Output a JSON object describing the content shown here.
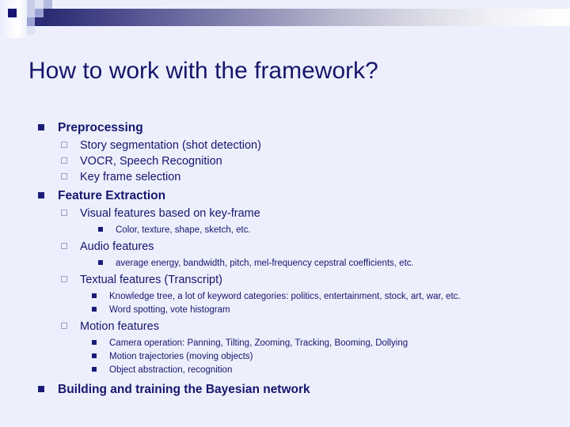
{
  "slide": {
    "title": "How to work with the framework?",
    "background_color": "#edf0fc",
    "text_color": "#15156e",
    "accent_color": "#1b1b78",
    "decoration": {
      "gradient_from": "#26266e",
      "gradient_to": "#ffffff"
    },
    "outline": [
      {
        "level": 1,
        "bullet": "filled-square-bullet",
        "text": "Preprocessing"
      },
      {
        "level": 2,
        "bullet": "hollow-square-bullet",
        "text": "Story segmentation (shot detection)"
      },
      {
        "level": 2,
        "bullet": "hollow-square-bullet",
        "text": "VOCR, Speech Recognition"
      },
      {
        "level": 2,
        "bullet": "hollow-square-bullet",
        "text": "Key frame selection"
      },
      {
        "level": 1,
        "bullet": "filled-square-bullet",
        "text": "Feature Extraction"
      },
      {
        "level": 2,
        "bullet": "hollow-square-bullet",
        "text": "Visual features based on key-frame"
      },
      {
        "level": 3,
        "bullet": "small-filled-square-bullet",
        "text": "Color, texture, shape, sketch, etc."
      },
      {
        "level": 2,
        "bullet": "hollow-square-bullet",
        "text": "Audio features"
      },
      {
        "level": 3,
        "bullet": "small-filled-square-bullet",
        "text": "average energy, bandwidth, pitch, mel-frequency cepstral coefficients, etc."
      },
      {
        "level": 2,
        "bullet": "hollow-square-bullet",
        "text": "Textual features (Transcript)"
      },
      {
        "level": 3,
        "bullet": "small-filled-square-bullet",
        "text": "Knowledge tree, a lot of keyword categories: politics, entertainment, stock, art, war, etc."
      },
      {
        "level": 3,
        "bullet": "small-filled-square-bullet",
        "text": "Word spotting, vote histogram"
      },
      {
        "level": 2,
        "bullet": "hollow-square-bullet",
        "text": "Motion features"
      },
      {
        "level": 3,
        "bullet": "small-filled-square-bullet",
        "text": "Camera operation: Panning, Tilting, Zooming, Tracking, Booming, Dollying"
      },
      {
        "level": 3,
        "bullet": "small-filled-square-bullet",
        "text": "Motion trajectories (moving objects)"
      },
      {
        "level": 3,
        "bullet": "small-filled-square-bullet",
        "text": "Object abstraction, recognition"
      },
      {
        "level": 1,
        "bullet": "filled-square-bullet",
        "text": "Building and training the Bayesian network"
      }
    ]
  }
}
